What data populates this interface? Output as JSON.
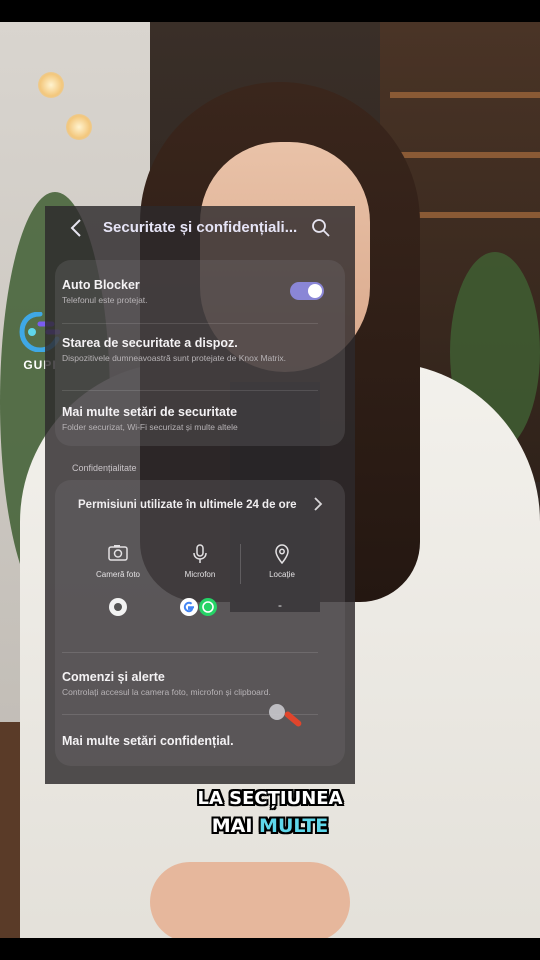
{
  "watermark": {
    "text": "GUPI"
  },
  "header": {
    "title": "Securitate și confidențiali...",
    "back_icon": "chevron-left-icon",
    "search_icon": "search-icon"
  },
  "security_card": {
    "auto_blocker": {
      "title": "Auto Blocker",
      "subtitle": "Telefonul este protejat.",
      "toggle_on": true
    },
    "device_status": {
      "title": "Starea de securitate a dispoz.",
      "subtitle": "Dispozitivele dumneavoastră sunt protejate de Knox Matrix."
    }
  },
  "more_security": {
    "title": "Mai multe setări de securitate",
    "subtitle": "Folder securizat, Wi-Fi securizat și multe altele"
  },
  "privacy_section_label": "Confidențialitate",
  "permissions": {
    "title": "Permisiuni utilizate în ultimele 24 de ore",
    "columns": [
      {
        "label": "Cameră foto",
        "icon": "camera-icon"
      },
      {
        "label": "Microfon",
        "icon": "microphone-icon"
      },
      {
        "label": "Locație",
        "icon": "location-pin-icon"
      }
    ],
    "location_value": "-"
  },
  "controls": {
    "title": "Comenzi și alerte",
    "subtitle": "Controlați accesul la camera foto, microfon și clipboard."
  },
  "more_privacy": {
    "title": "Mai multe setări confidențial."
  },
  "captions": {
    "line1": "LA SECȚIUNEA",
    "line2_a": "MAI",
    "line2_b": "MULTE"
  },
  "colors": {
    "accent": "#8a86d6",
    "caption_highlight": "#5fd7ea",
    "touch_trail": "#e0452c"
  }
}
